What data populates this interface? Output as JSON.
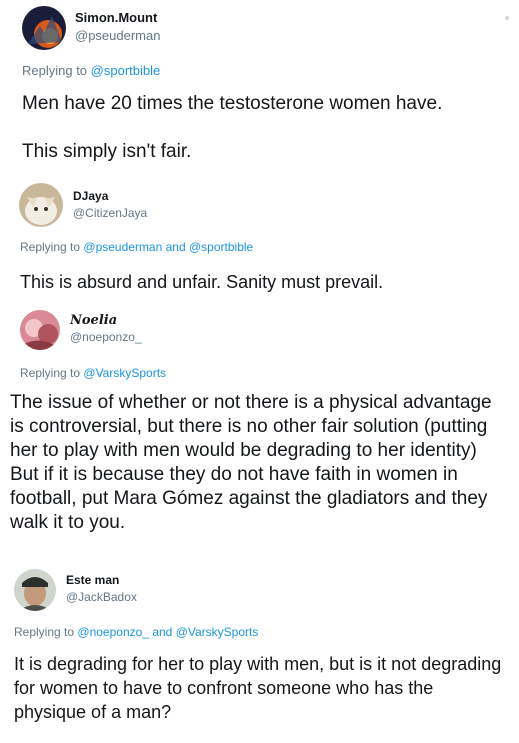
{
  "tweets": [
    {
      "display_name": "Simon.Mount",
      "handle": "@pseuderman",
      "reply_prefix": "Replying to",
      "mention_1": "@sportbible",
      "mention_2": "",
      "text_line_1": "Men have 20 times the testosterone women have.",
      "text_line_2": "This simply isn't fair."
    },
    {
      "display_name": "DJaya",
      "handle": "@CitizenJaya",
      "reply_prefix": "Replying to",
      "mention_1": "@pseuderman",
      "joiner": "and",
      "mention_2": "@sportbible",
      "text": "This is absurd and unfair. Sanity must prevail."
    },
    {
      "display_name": "Noelia",
      "handle": "@noeponzo_",
      "reply_prefix": "Replying to",
      "mention_1": "@VarskySports",
      "text": "The issue of whether or not there is a physical advantage is controversial, but there is no other fair solution (putting her to play with men would be degrading to her identity) But if it is because they do not have faith in women in football, put Mara Gómez against the gladiators and they walk it to you."
    },
    {
      "display_name": "Este man",
      "handle": "@JackBadox",
      "reply_prefix": "Replying to",
      "mention_1": "@noeponzo_",
      "joiner": "and",
      "mention_2": "@VarskySports",
      "text": "It is degrading for her to play with men, but is it not degrading for women to have to confront someone who has the physique of a man?"
    }
  ],
  "colors": {
    "text": "#14171a",
    "secondary": "#657786",
    "link": "#1b95e0"
  }
}
